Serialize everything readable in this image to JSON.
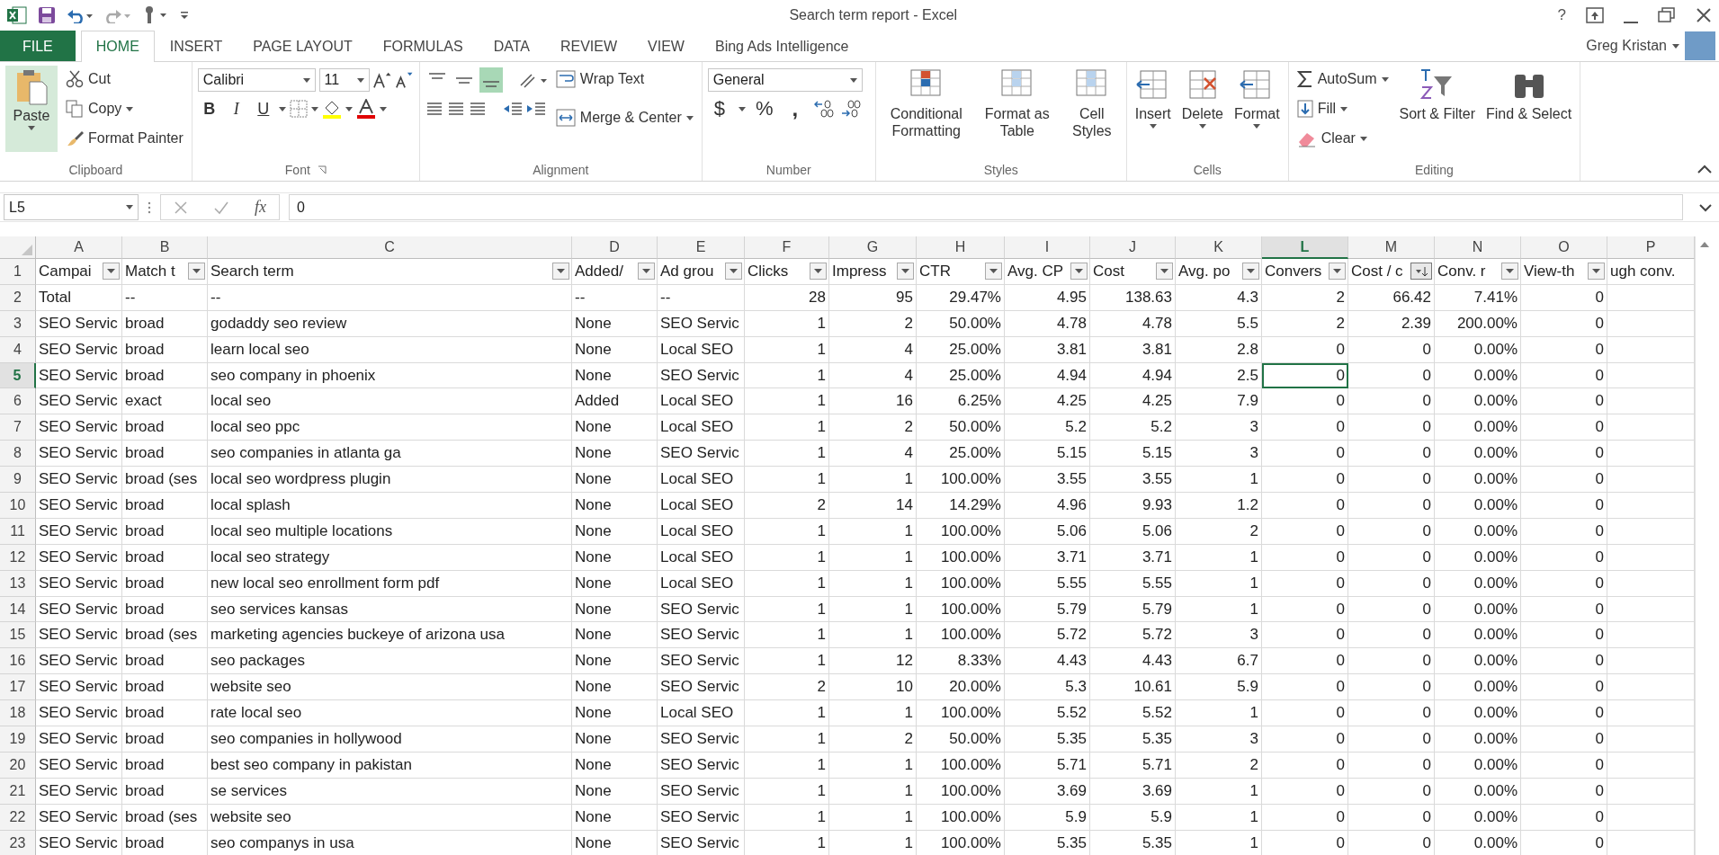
{
  "window": {
    "title": "Search term report - Excel",
    "user": "Greg Kristan",
    "help": "?"
  },
  "tabs": [
    {
      "label": "FILE",
      "kind": "file",
      "selected": false
    },
    {
      "label": "HOME",
      "kind": "tab",
      "selected": true
    },
    {
      "label": "INSERT",
      "kind": "tab",
      "selected": false
    },
    {
      "label": "PAGE LAYOUT",
      "kind": "tab",
      "selected": false
    },
    {
      "label": "FORMULAS",
      "kind": "tab",
      "selected": false
    },
    {
      "label": "DATA",
      "kind": "tab",
      "selected": false
    },
    {
      "label": "REVIEW",
      "kind": "tab",
      "selected": false
    },
    {
      "label": "VIEW",
      "kind": "tab",
      "selected": false
    },
    {
      "label": "Bing Ads Intelligence",
      "kind": "tab",
      "selected": false
    }
  ],
  "ribbon": {
    "clipboard": {
      "label": "Clipboard",
      "paste": "Paste",
      "cut": "Cut",
      "copy": "Copy",
      "format_painter": "Format Painter"
    },
    "font": {
      "label": "Font",
      "name": "Calibri",
      "size": "11",
      "bold": "B",
      "italic": "I",
      "underline": "U"
    },
    "alignment": {
      "label": "Alignment",
      "vertical": [
        {
          "selected": false
        },
        {
          "selected": false
        },
        {
          "selected": true
        }
      ],
      "wrap_text": "Wrap Text",
      "merge_center": "Merge & Center"
    },
    "number": {
      "label": "Number",
      "format": "General",
      "currency": "$",
      "percent": "%",
      "comma": ","
    },
    "styles": {
      "label": "Styles",
      "items": [
        "Conditional Formatting",
        "Format as Table",
        "Cell Styles"
      ]
    },
    "cells": {
      "label": "Cells",
      "items": [
        "Insert",
        "Delete",
        "Format"
      ]
    },
    "editing": {
      "label": "Editing",
      "autosum": "AutoSum",
      "fill": "Fill",
      "clear": "Clear",
      "sort_filter": "Sort & Filter",
      "find_select": "Find & Select"
    }
  },
  "formula_bar": {
    "name_box": "L5",
    "fx": "fx",
    "value": "0"
  },
  "columns": [
    {
      "letter": "A",
      "kind": "text",
      "selected": false
    },
    {
      "letter": "B",
      "kind": "text",
      "selected": false
    },
    {
      "letter": "C",
      "kind": "text",
      "selected": false
    },
    {
      "letter": "D",
      "kind": "text",
      "selected": false
    },
    {
      "letter": "E",
      "kind": "text",
      "selected": false
    },
    {
      "letter": "F",
      "kind": "number",
      "selected": false
    },
    {
      "letter": "G",
      "kind": "number",
      "selected": false
    },
    {
      "letter": "H",
      "kind": "number",
      "selected": false
    },
    {
      "letter": "I",
      "kind": "number",
      "selected": false
    },
    {
      "letter": "J",
      "kind": "number",
      "selected": false
    },
    {
      "letter": "K",
      "kind": "number",
      "selected": false
    },
    {
      "letter": "L",
      "kind": "number",
      "selected": true
    },
    {
      "letter": "M",
      "kind": "number",
      "selected": false
    },
    {
      "letter": "N",
      "kind": "number",
      "selected": false
    },
    {
      "letter": "O",
      "kind": "number",
      "selected": false
    },
    {
      "letter": "P",
      "kind": "text",
      "selected": false
    }
  ],
  "header": {
    "num": "1",
    "cells": [
      {
        "text": "Campai",
        "filter": true,
        "sorted": false
      },
      {
        "text": "Match t",
        "filter": true,
        "sorted": false
      },
      {
        "text": "Search term",
        "filter": true,
        "sorted": false
      },
      {
        "text": "Added/",
        "filter": true,
        "sorted": false
      },
      {
        "text": "Ad grou",
        "filter": true,
        "sorted": false
      },
      {
        "text": "Clicks",
        "filter": true,
        "sorted": false
      },
      {
        "text": "Impress",
        "filter": true,
        "sorted": false
      },
      {
        "text": "CTR",
        "filter": true,
        "sorted": false
      },
      {
        "text": "Avg. CP",
        "filter": true,
        "sorted": false
      },
      {
        "text": "Cost",
        "filter": true,
        "sorted": false
      },
      {
        "text": "Avg. po",
        "filter": true,
        "sorted": false
      },
      {
        "text": "Convers",
        "filter": true,
        "sorted": false
      },
      {
        "text": "Cost / c",
        "filter": true,
        "sorted": true
      },
      {
        "text": "Conv. r",
        "filter": true,
        "sorted": false
      },
      {
        "text": "View-th",
        "filter": true,
        "sorted": false
      },
      {
        "text": "ugh conv.",
        "filter": false
      }
    ]
  },
  "rows": [
    {
      "num": "2",
      "selected": false,
      "cells": [
        "Total",
        "--",
        "--",
        "--",
        "--",
        "28",
        "95",
        "29.47%",
        "4.95",
        "138.63",
        "4.3",
        "2",
        "66.42",
        "7.41%",
        "0"
      ]
    },
    {
      "num": "3",
      "selected": false,
      "cells": [
        "SEO Servic",
        "broad",
        "godaddy seo review",
        "None",
        "SEO Servic",
        "1",
        "2",
        "50.00%",
        "4.78",
        "4.78",
        "5.5",
        "2",
        "2.39",
        "200.00%",
        "0"
      ]
    },
    {
      "num": "4",
      "selected": false,
      "cells": [
        "SEO Servic",
        "broad",
        "learn local seo",
        "None",
        "Local SEO",
        "1",
        "4",
        "25.00%",
        "3.81",
        "3.81",
        "2.8",
        "0",
        "0",
        "0.00%",
        "0"
      ]
    },
    {
      "num": "5",
      "selected": true,
      "cells": [
        "SEO Servic",
        "broad",
        "seo company in phoenix",
        "None",
        "SEO Servic",
        "1",
        "4",
        "25.00%",
        "4.94",
        "4.94",
        "2.5",
        "0",
        "0",
        "0.00%",
        "0"
      ]
    },
    {
      "num": "6",
      "selected": false,
      "cells": [
        "SEO Servic",
        "exact",
        "local seo",
        "Added",
        "Local SEO",
        "1",
        "16",
        "6.25%",
        "4.25",
        "4.25",
        "7.9",
        "0",
        "0",
        "0.00%",
        "0"
      ]
    },
    {
      "num": "7",
      "selected": false,
      "cells": [
        "SEO Servic",
        "broad",
        "local seo ppc",
        "None",
        "Local SEO",
        "1",
        "2",
        "50.00%",
        "5.2",
        "5.2",
        "3",
        "0",
        "0",
        "0.00%",
        "0"
      ]
    },
    {
      "num": "8",
      "selected": false,
      "cells": [
        "SEO Servic",
        "broad",
        "seo companies in atlanta ga",
        "None",
        "SEO Servic",
        "1",
        "4",
        "25.00%",
        "5.15",
        "5.15",
        "3",
        "0",
        "0",
        "0.00%",
        "0"
      ]
    },
    {
      "num": "9",
      "selected": false,
      "cells": [
        "SEO Servic",
        "broad (ses",
        "local seo wordpress plugin",
        "None",
        "Local SEO",
        "1",
        "1",
        "100.00%",
        "3.55",
        "3.55",
        "1",
        "0",
        "0",
        "0.00%",
        "0"
      ]
    },
    {
      "num": "10",
      "selected": false,
      "cells": [
        "SEO Servic",
        "broad",
        "local splash",
        "None",
        "Local SEO",
        "2",
        "14",
        "14.29%",
        "4.96",
        "9.93",
        "1.2",
        "0",
        "0",
        "0.00%",
        "0"
      ]
    },
    {
      "num": "11",
      "selected": false,
      "cells": [
        "SEO Servic",
        "broad",
        "local seo multiple locations",
        "None",
        "Local SEO",
        "1",
        "1",
        "100.00%",
        "5.06",
        "5.06",
        "2",
        "0",
        "0",
        "0.00%",
        "0"
      ]
    },
    {
      "num": "12",
      "selected": false,
      "cells": [
        "SEO Servic",
        "broad",
        "local seo strategy",
        "None",
        "Local SEO",
        "1",
        "1",
        "100.00%",
        "3.71",
        "3.71",
        "1",
        "0",
        "0",
        "0.00%",
        "0"
      ]
    },
    {
      "num": "13",
      "selected": false,
      "cells": [
        "SEO Servic",
        "broad",
        "new local seo enrollment form pdf",
        "None",
        "Local SEO",
        "1",
        "1",
        "100.00%",
        "5.55",
        "5.55",
        "1",
        "0",
        "0",
        "0.00%",
        "0"
      ]
    },
    {
      "num": "14",
      "selected": false,
      "cells": [
        "SEO Servic",
        "broad",
        "seo services kansas",
        "None",
        "SEO Servic",
        "1",
        "1",
        "100.00%",
        "5.79",
        "5.79",
        "1",
        "0",
        "0",
        "0.00%",
        "0"
      ]
    },
    {
      "num": "15",
      "selected": false,
      "cells": [
        "SEO Servic",
        "broad (ses",
        "marketing agencies buckeye of arizona usa",
        "None",
        "SEO Servic",
        "1",
        "1",
        "100.00%",
        "5.72",
        "5.72",
        "3",
        "0",
        "0",
        "0.00%",
        "0"
      ]
    },
    {
      "num": "16",
      "selected": false,
      "cells": [
        "SEO Servic",
        "broad",
        "seo packages",
        "None",
        "SEO Servic",
        "1",
        "12",
        "8.33%",
        "4.43",
        "4.43",
        "6.7",
        "0",
        "0",
        "0.00%",
        "0"
      ]
    },
    {
      "num": "17",
      "selected": false,
      "cells": [
        "SEO Servic",
        "broad",
        "website seo",
        "None",
        "SEO Servic",
        "2",
        "10",
        "20.00%",
        "5.3",
        "10.61",
        "5.9",
        "0",
        "0",
        "0.00%",
        "0"
      ]
    },
    {
      "num": "18",
      "selected": false,
      "cells": [
        "SEO Servic",
        "broad",
        "rate local seo",
        "None",
        "Local SEO",
        "1",
        "1",
        "100.00%",
        "5.52",
        "5.52",
        "1",
        "0",
        "0",
        "0.00%",
        "0"
      ]
    },
    {
      "num": "19",
      "selected": false,
      "cells": [
        "SEO Servic",
        "broad",
        "seo companies in hollywood",
        "None",
        "SEO Servic",
        "1",
        "2",
        "50.00%",
        "5.35",
        "5.35",
        "3",
        "0",
        "0",
        "0.00%",
        "0"
      ]
    },
    {
      "num": "20",
      "selected": false,
      "cells": [
        "SEO Servic",
        "broad",
        "best seo company in pakistan",
        "None",
        "SEO Servic",
        "1",
        "1",
        "100.00%",
        "5.71",
        "5.71",
        "2",
        "0",
        "0",
        "0.00%",
        "0"
      ]
    },
    {
      "num": "21",
      "selected": false,
      "cells": [
        "SEO Servic",
        "broad",
        "se services",
        "None",
        "SEO Servic",
        "1",
        "1",
        "100.00%",
        "3.69",
        "3.69",
        "1",
        "0",
        "0",
        "0.00%",
        "0"
      ]
    },
    {
      "num": "22",
      "selected": false,
      "cells": [
        "SEO Servic",
        "broad (ses",
        "website seo",
        "None",
        "SEO Servic",
        "1",
        "1",
        "100.00%",
        "5.9",
        "5.9",
        "1",
        "0",
        "0",
        "0.00%",
        "0"
      ]
    },
    {
      "num": "23",
      "selected": false,
      "cells": [
        "SEO Servic",
        "broad",
        "seo companys in usa",
        "None",
        "SEO Servic",
        "1",
        "1",
        "100.00%",
        "5.35",
        "5.35",
        "1",
        "0",
        "0",
        "0.00%",
        "0"
      ]
    }
  ]
}
